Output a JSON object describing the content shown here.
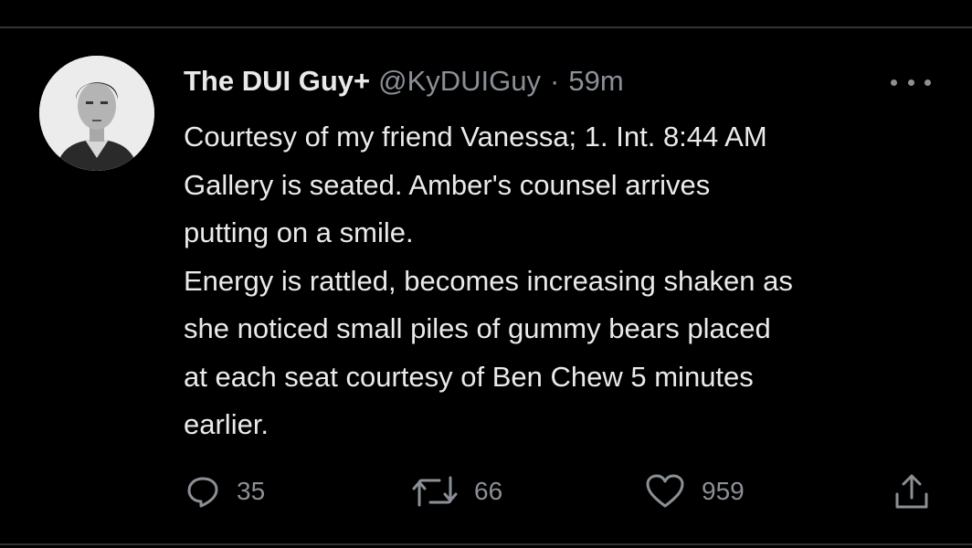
{
  "tweet": {
    "display_name": "The DUI Guy+",
    "handle": "@KyDUIGuy",
    "separator": "·",
    "time": "59m",
    "body": "Courtesy of my friend Vanessa; 1. Int. 8:44 AM\nGallery is seated. Amber's counsel arrives\nputting on a smile.\nEnergy is rattled, becomes increasing shaken as\nshe noticed small piles of gummy bears placed\nat each seat courtesy of Ben Chew 5 minutes\nearlier."
  },
  "actions": {
    "reply_icon": "reply-icon",
    "reply_count": "35",
    "retweet_icon": "retweet-icon",
    "retweet_count": "66",
    "like_icon": "heart-icon",
    "like_count": "959",
    "share_icon": "share-icon"
  },
  "colors": {
    "background": "#000000",
    "text_primary": "#e7e9ea",
    "text_secondary": "#8b9096",
    "divider": "#2f3336"
  }
}
